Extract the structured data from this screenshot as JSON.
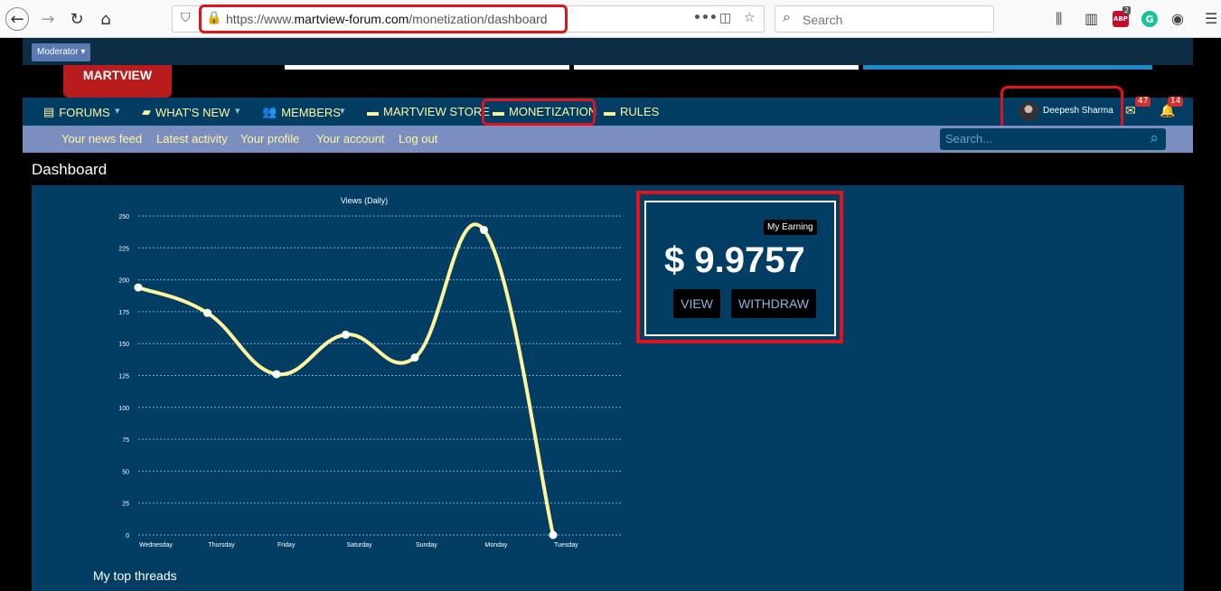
{
  "browser": {
    "url_prefix": "https://www.",
    "url_domain": "martview-forum.com",
    "url_path": "/monetization/dashboard",
    "search_placeholder": "Search",
    "abp_label": "ABP",
    "abp_count": "2",
    "grammarly_label": "G"
  },
  "header": {
    "moderator_label": "Moderator ▾",
    "logo_text": "MARTVIEW"
  },
  "nav": {
    "forums": "FORUMS",
    "whats_new": "WHAT'S NEW",
    "members": "MEMBERS",
    "store": "MARTVIEW STORE",
    "monetization": "MONETIZATION",
    "rules": "RULES",
    "username": "Deepesh Sharma",
    "inbox_count": "47",
    "alerts_count": "14"
  },
  "subnav": {
    "items": [
      "Your news feed",
      "Latest activity",
      "Your profile",
      "Your account",
      "Log out"
    ],
    "search_placeholder": "Search..."
  },
  "page": {
    "title": "Dashboard",
    "top_threads": "My top threads"
  },
  "earnings": {
    "tag": "My Earning",
    "amount": "$ 9.9757",
    "view_label": "VIEW",
    "withdraw_label": "WITHDRAW"
  },
  "colors": {
    "line": "#fff59d",
    "panel": "#023e63",
    "nav_text": "#fff59d"
  },
  "chart_data": {
    "type": "line",
    "title": "Views (Daily)",
    "categories": [
      "Wednesday",
      "Thursday",
      "Friday",
      "Saturday",
      "Sunday",
      "Monday",
      "Tuesday"
    ],
    "values": [
      194,
      174,
      126,
      157,
      139,
      239,
      0
    ],
    "yticks": [
      0,
      25,
      50,
      75,
      100,
      125,
      150,
      175,
      200,
      225,
      250
    ],
    "ylim": [
      0,
      250
    ],
    "grid": true
  }
}
